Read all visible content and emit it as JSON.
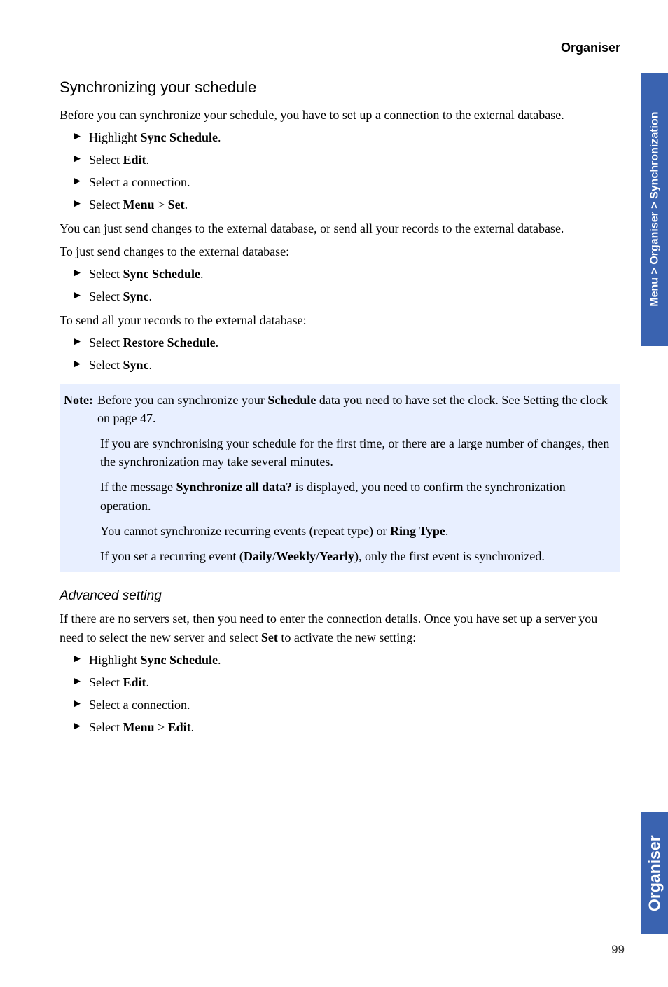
{
  "header": {
    "title": "Organiser"
  },
  "section1": {
    "heading": "Synchronizing your schedule",
    "intro": "Before you can synchronize your schedule, you have to set up a connection to the external database.",
    "steps1": [
      {
        "pre": "Highlight ",
        "bold": "Sync Schedule",
        "post": "."
      },
      {
        "pre": "Select ",
        "bold": "Edit",
        "post": "."
      },
      {
        "pre": "Select a connection.",
        "bold": "",
        "post": ""
      },
      {
        "pre": "Select ",
        "bold": "Menu",
        "mid": " > ",
        "bold2": "Set",
        "post": "."
      }
    ],
    "para2": "You can just send changes to the external database, or send all your records to the external database.",
    "para3": "To just send changes to the external database:",
    "steps2": [
      {
        "pre": "Select ",
        "bold": "Sync Schedule",
        "post": "."
      },
      {
        "pre": "Select ",
        "bold": "Sync",
        "post": "."
      }
    ],
    "para4": "To send all your records to the external database:",
    "steps3": [
      {
        "pre": "Select ",
        "bold": "Restore Schedule",
        "post": "."
      },
      {
        "pre": "Select ",
        "bold": "Sync",
        "post": "."
      }
    ]
  },
  "note": {
    "label": "Note:",
    "p1a": "Before you can synchronize your ",
    "p1b": "Schedule",
    "p1c": " data you need to have set the clock. See Setting the clock on page 47.",
    "p2": "If you are synchronising your schedule for the first time, or there are a large number of changes, then the synchronization may take several minutes.",
    "p3a": "If the message ",
    "p3b": "Synchronize all data?",
    "p3c": " is displayed, you need to confirm the synchronization operation.",
    "p4a": "You cannot synchronize recurring events (repeat type) or ",
    "p4b": "Ring Type",
    "p4c": ".",
    "p5a": "If you set a recurring event (",
    "p5b": "Daily",
    "p5s1": "/",
    "p5c": "Weekly",
    "p5s2": "/",
    "p5d": "Yearly",
    "p5e": "), only the first event is synchronized."
  },
  "section2": {
    "heading": "Advanced setting",
    "intro_a": "If there are no servers set, then you need to enter the connection details. Once you have set up a server you need to select the new server and select ",
    "intro_b": "Set",
    "intro_c": " to activate the new setting:",
    "steps": [
      {
        "pre": "Highlight ",
        "bold": "Sync Schedule",
        "post": "."
      },
      {
        "pre": "Select ",
        "bold": "Edit",
        "post": "."
      },
      {
        "pre": "Select a connection.",
        "bold": "",
        "post": ""
      },
      {
        "pre": "Select ",
        "bold": "Menu",
        "mid": " > ",
        "bold2": "Edit",
        "post": "."
      }
    ]
  },
  "tabs": {
    "breadcrumb": "Menu > Organiser > Synchronization",
    "chapter": "Organiser"
  },
  "pageNumber": "99"
}
